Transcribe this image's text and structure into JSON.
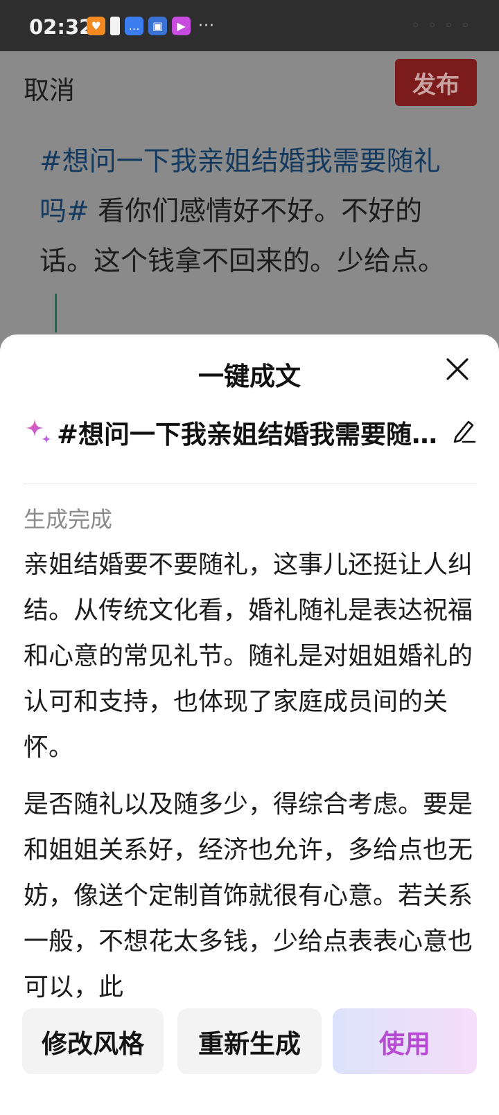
{
  "status_bar": {
    "time": "02:32",
    "dots": "···",
    "right_text": "◦ ◦ ◦ ◦"
  },
  "editor": {
    "cancel_label": "取消",
    "publish_label": "发布",
    "hashtag": "#想问一下我亲姐结婚我需要随礼吗#",
    "body": " 看你们感情好不好。不好的话。这个钱拿不回来的。少给点。"
  },
  "sheet": {
    "title": "一键成文",
    "prompt": "#想问一下我亲姐结婚我需要随礼吗# 看你们感情好不好。不好的话。这个钱拿不回来的。少给点。",
    "status": "生成完成",
    "paragraphs": [
      "亲姐结婚要不要随礼，这事儿还挺让人纠结。从传统文化看，婚礼随礼是表达祝福和心意的常见礼节。随礼是对姐姐婚礼的认可和支持，也体现了家庭成员间的关怀。",
      "是否随礼以及随多少，得综合考虑。要是和姐姐关系好，经济也允许，多给点也无妨，像送个定制首饰就很有心意。若关系一般，不想花太多钱，少给点表表心意也可以，此"
    ],
    "buttons": {
      "style": "修改风格",
      "regenerate": "重新生成",
      "use": "使用"
    }
  },
  "colors": {
    "hashtag": "#14395e",
    "publish_bg": "#7b1b1b",
    "use_text": "#b64ad2",
    "status_bar_bg": "#2e2e2e"
  }
}
